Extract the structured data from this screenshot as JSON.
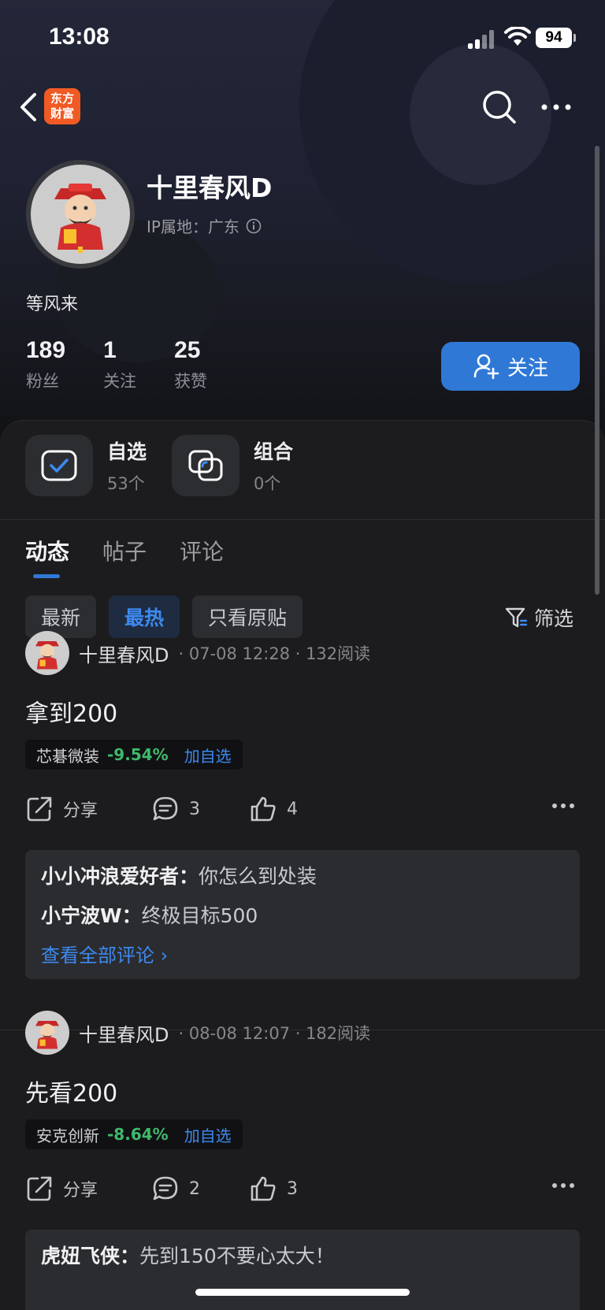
{
  "status_bar": {
    "time": "13:08",
    "battery": "94"
  },
  "nav": {
    "logo_text_line1": "东方",
    "logo_text_line2": "财富"
  },
  "profile": {
    "name": "十里春风D",
    "ip_location": "IP属地：广东",
    "bio": "等风来",
    "stats": [
      {
        "value": "189",
        "label": "粉丝"
      },
      {
        "value": "1",
        "label": "关注"
      },
      {
        "value": "25",
        "label": "获赞"
      }
    ],
    "follow_label": "关注"
  },
  "quick": {
    "watchlist": {
      "title": "自选",
      "sub": "53个"
    },
    "portfolio": {
      "title": "组合",
      "sub": "0个"
    }
  },
  "tabs": [
    "动态",
    "帖子",
    "评论"
  ],
  "filters": [
    "最新",
    "最热",
    "只看原贴"
  ],
  "filter_button": "筛选",
  "posts": [
    {
      "author": "十里春风D",
      "meta": "· 07-08 12:28 · 132阅读",
      "body": "拿到200",
      "stock_name": "芯碁微装",
      "stock_change": "-9.54%",
      "add_label": "加自选",
      "share_label": "分享",
      "comment_count": "3",
      "like_count": "4",
      "comments": [
        {
          "user": "小小冲浪爱好者：",
          "text": "你怎么到处装"
        },
        {
          "user": "小宁波W：",
          "text": "终极目标500"
        }
      ],
      "view_all": "查看全部评论 ›"
    },
    {
      "author": "十里春风D",
      "meta": "· 08-08 12:07 · 182阅读",
      "body": "先看200",
      "stock_name": "安克创新",
      "stock_change": "-8.64%",
      "add_label": "加自选",
      "share_label": "分享",
      "comment_count": "2",
      "like_count": "3",
      "comments": [
        {
          "user": "虎妞飞侠：",
          "text": "先到150不要心太大！"
        }
      ]
    }
  ],
  "colors": {
    "accent": "#2f78d6",
    "down_green": "#3fb96b",
    "logo": "#f05a24"
  }
}
